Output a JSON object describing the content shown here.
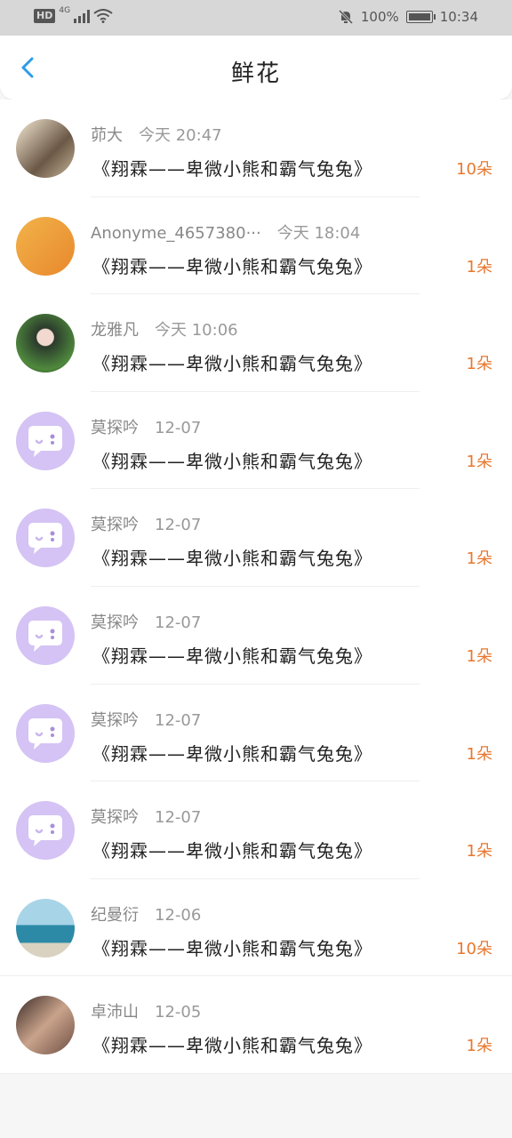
{
  "status_bar": {
    "hd": "HD",
    "network": "4G",
    "battery": "100%",
    "battery_level": 1.0,
    "time": "10:34"
  },
  "header": {
    "title": "鲜花",
    "back_icon": "back-arrow-icon",
    "accent_color": "#2e9be8"
  },
  "items": [
    {
      "name": "茆大",
      "time": "今天 20:47",
      "gift": "《翔霖——卑微小熊和霸气兔兔》",
      "count": "10朵",
      "avatar": "photo"
    },
    {
      "name": "Anonyme_4657380···",
      "time": "今天 18:04",
      "gift": "《翔霖——卑微小熊和霸气兔兔》",
      "count": "1朵",
      "avatar": "photo"
    },
    {
      "name": "龙雅凡",
      "time": "今天 10:06",
      "gift": "《翔霖——卑微小熊和霸气兔兔》",
      "count": "1朵",
      "avatar": "photo"
    },
    {
      "name": "莫探吟",
      "time": "12-07",
      "gift": "《翔霖——卑微小熊和霸气兔兔》",
      "count": "1朵",
      "avatar": "default-chat-bubble"
    },
    {
      "name": "莫探吟",
      "time": "12-07",
      "gift": "《翔霖——卑微小熊和霸气兔兔》",
      "count": "1朵",
      "avatar": "default-chat-bubble"
    },
    {
      "name": "莫探吟",
      "time": "12-07",
      "gift": "《翔霖——卑微小熊和霸气兔兔》",
      "count": "1朵",
      "avatar": "default-chat-bubble"
    },
    {
      "name": "莫探吟",
      "time": "12-07",
      "gift": "《翔霖——卑微小熊和霸气兔兔》",
      "count": "1朵",
      "avatar": "default-chat-bubble"
    },
    {
      "name": "莫探吟",
      "time": "12-07",
      "gift": "《翔霖——卑微小熊和霸气兔兔》",
      "count": "1朵",
      "avatar": "default-chat-bubble"
    },
    {
      "name": "纪曼衍",
      "time": "12-06",
      "gift": "《翔霖——卑微小熊和霸气兔兔》",
      "count": "10朵",
      "avatar": "photo"
    },
    {
      "name": "卓沛山",
      "time": "12-05",
      "gift": "《翔霖——卑微小熊和霸气兔兔》",
      "count": "1朵",
      "avatar": "photo"
    }
  ],
  "colors": {
    "count": "#e8772e",
    "default_avatar": "#d4c3f4"
  }
}
